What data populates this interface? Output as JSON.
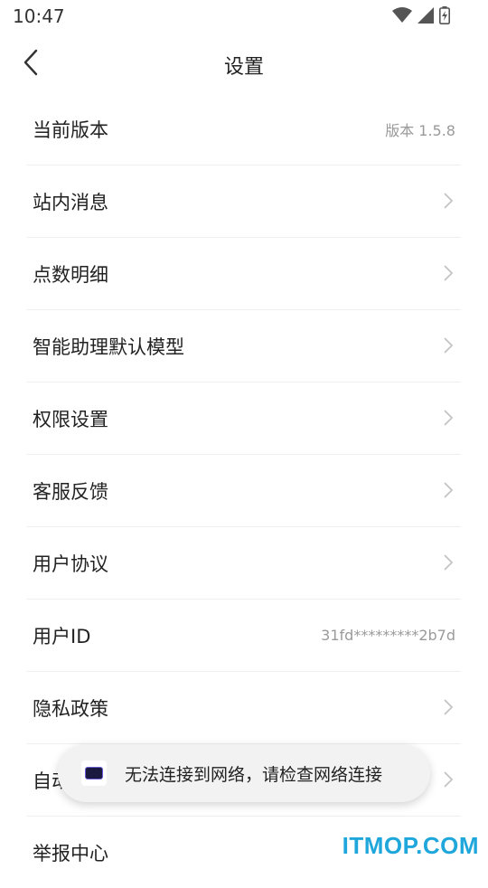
{
  "status_bar": {
    "time": "10:47"
  },
  "header": {
    "title": "设置"
  },
  "settings": {
    "items": [
      {
        "label": "当前版本",
        "value": "版本 1.5.8"
      },
      {
        "label": "站内消息"
      },
      {
        "label": "点数明细"
      },
      {
        "label": "智能助理默认模型"
      },
      {
        "label": "权限设置"
      },
      {
        "label": "客服反馈"
      },
      {
        "label": "用户协议"
      },
      {
        "label": "用户ID",
        "value": "31fd*********2b7d"
      },
      {
        "label": "隐私政策"
      },
      {
        "label": "自动续费"
      },
      {
        "label": "举报中心"
      }
    ]
  },
  "toast": {
    "message": "无法连接到网络，请检查网络连接"
  },
  "watermark": {
    "text": "ITMOP.COM"
  }
}
